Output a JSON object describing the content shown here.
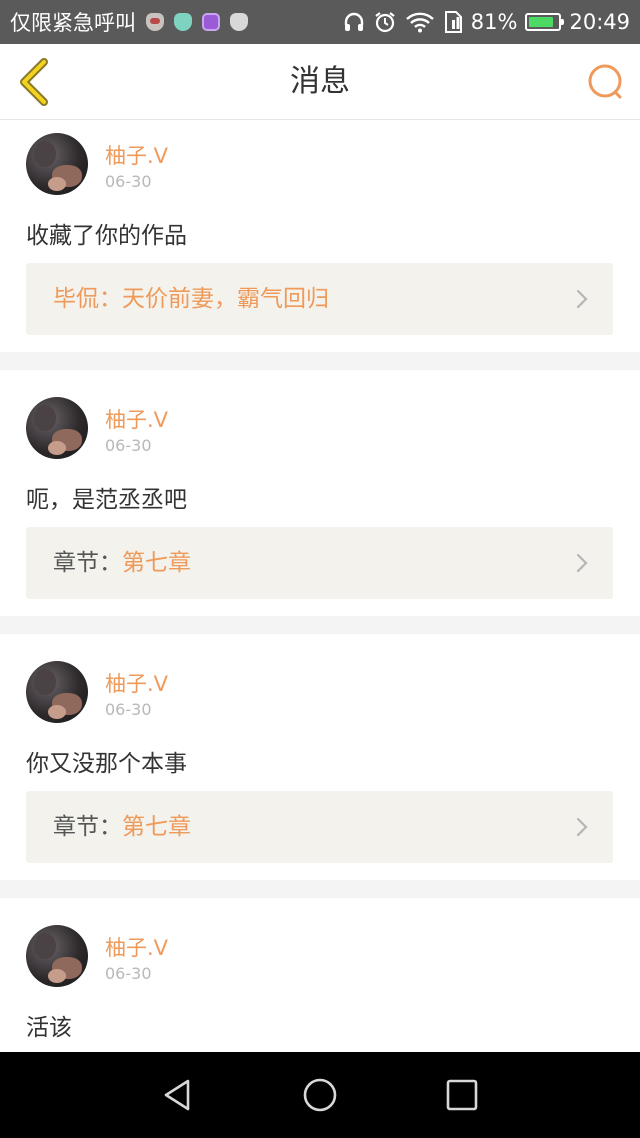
{
  "status_bar": {
    "carrier": "仅限紧急呼叫",
    "notification_icons": [
      "cup-icon",
      "cup-icon",
      "gallery-icon",
      "cup-icon"
    ],
    "battery_percent": "81%",
    "time": "20:49"
  },
  "header": {
    "title": "消息",
    "accent_color": "#ef9a5a"
  },
  "messages": [
    {
      "username": "柚子.V",
      "date": "06-30",
      "text": "收藏了你的作品",
      "ref_label": "",
      "ref_value": "毕侃：天价前妻，霸气回归"
    },
    {
      "username": "柚子.V",
      "date": "06-30",
      "text": "呃，是范丞丞吧",
      "ref_label": "章节：",
      "ref_value": "第七章"
    },
    {
      "username": "柚子.V",
      "date": "06-30",
      "text": "你又没那个本事",
      "ref_label": "章节：",
      "ref_value": "第七章"
    },
    {
      "username": "柚子.V",
      "date": "06-30",
      "text": "活该"
    }
  ],
  "nav": {
    "icons": [
      "back-triangle-icon",
      "home-circle-icon",
      "recents-square-icon"
    ]
  }
}
